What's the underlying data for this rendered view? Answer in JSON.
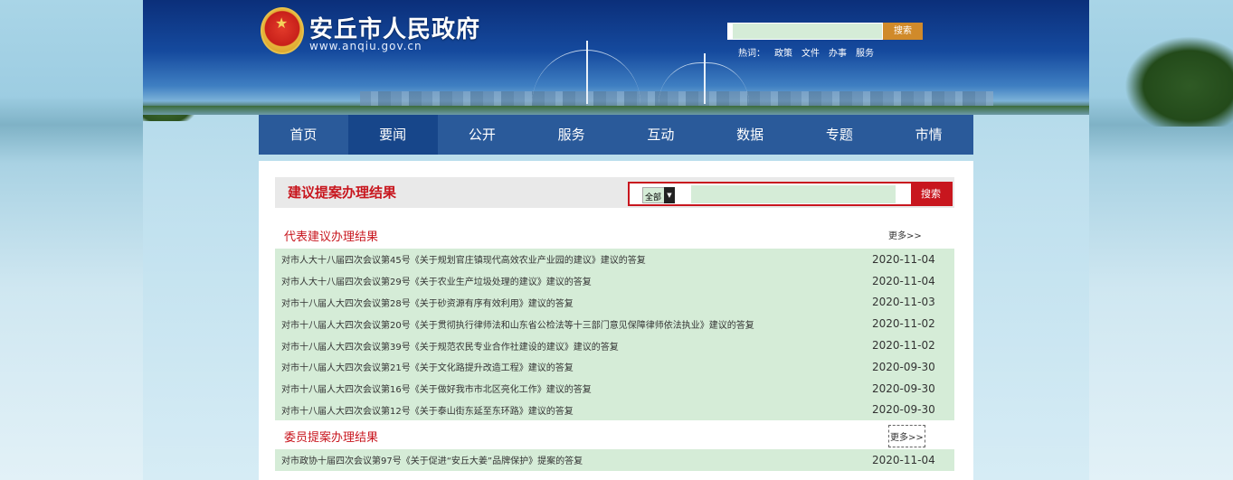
{
  "site": {
    "title": "安丘市人民政府",
    "url": "www.anqiu.gov.cn"
  },
  "top_search": {
    "button_label": "搜索",
    "hot_label": "热词：",
    "hot_words": [
      "政策",
      "文件",
      "办事",
      "服务"
    ]
  },
  "nav": {
    "items": [
      {
        "label": "首页"
      },
      {
        "label": "要闻"
      },
      {
        "label": "公开"
      },
      {
        "label": "服务"
      },
      {
        "label": "互动"
      },
      {
        "label": "数据"
      },
      {
        "label": "专题"
      },
      {
        "label": "市情"
      }
    ],
    "active_index": 2
  },
  "page": {
    "title": "建议提案办理结果",
    "search": {
      "select_value": "全部",
      "button_label": "搜索"
    }
  },
  "sections": [
    {
      "label": "代表建议办理结果",
      "more_label": "更多>>",
      "rows": [
        {
          "title": "对市人大十八届四次会议第45号《关于规划官庄镇现代高效农业产业园的建议》建议的答复",
          "date": "2020-11-04"
        },
        {
          "title": "对市人大十八届四次会议第29号《关于农业生产垃圾处理的建议》建议的答复",
          "date": "2020-11-04"
        },
        {
          "title": "对市十八届人大四次会议第28号《关于砂资源有序有效利用》建议的答复",
          "date": "2020-11-03"
        },
        {
          "title": "对市十八届人大四次会议第20号《关于贯彻执行律师法和山东省公检法等十三部门意见保障律师依法执业》建议的答复",
          "date": "2020-11-02"
        },
        {
          "title": "对市十八届人大四次会议第39号《关于规范农民专业合作社建设的建议》建议的答复",
          "date": "2020-11-02"
        },
        {
          "title": "对市十八届人大四次会议第21号《关于文化路提升改造工程》建议的答复",
          "date": "2020-09-30"
        },
        {
          "title": "对市十八届人大四次会议第16号《关于做好我市市北区亮化工作》建议的答复",
          "date": "2020-09-30"
        },
        {
          "title": "对市十八届人大四次会议第12号《关于泰山街东延至东环路》建议的答复",
          "date": "2020-09-30"
        }
      ]
    },
    {
      "label": "委员提案办理结果",
      "more_label": "更多>>",
      "rows": [
        {
          "title": "对市政协十届四次会议第97号《关于促进“安丘大姜”品牌保护》提案的答复",
          "date": "2020-11-04"
        }
      ]
    }
  ],
  "colors": {
    "accent_red": "#c8161e",
    "nav_blue": "#2a5a9a",
    "row_green": "#d5ecd7"
  }
}
